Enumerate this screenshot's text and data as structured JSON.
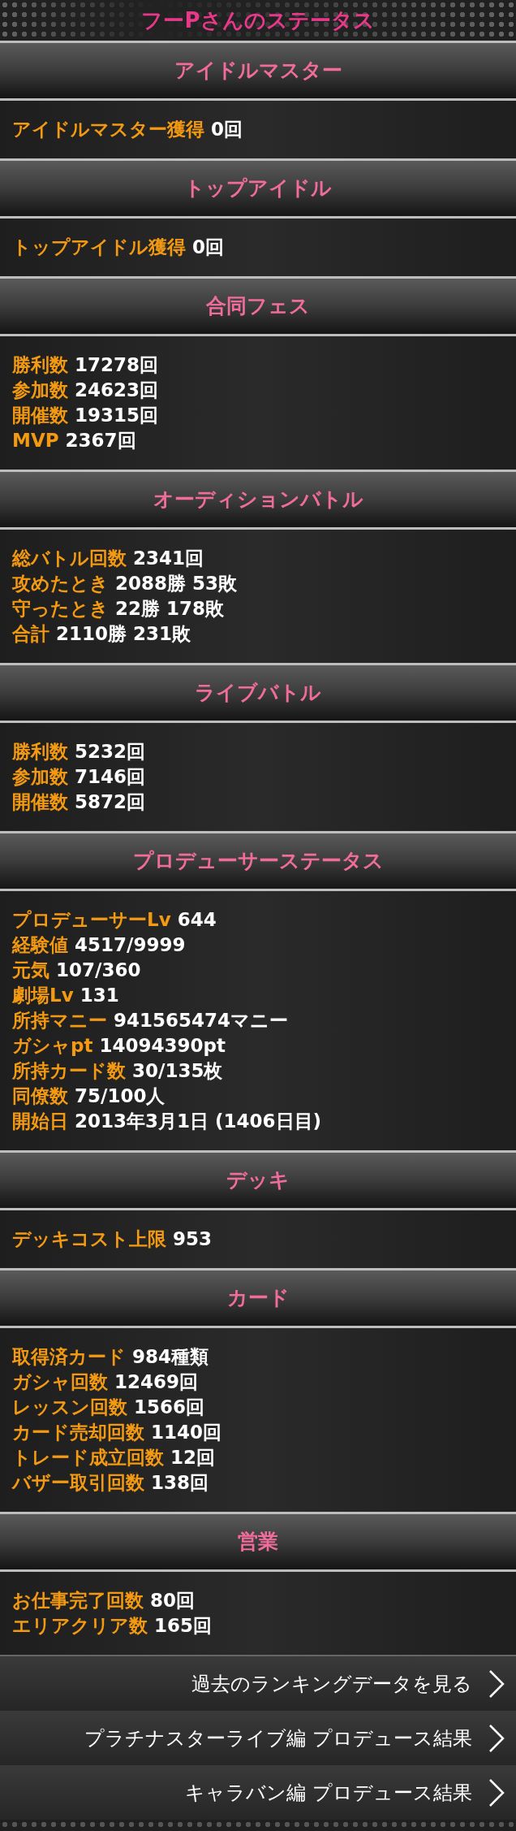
{
  "title": "フーPさんのステータス",
  "sections": [
    {
      "heading": "アイドルマスター",
      "rows": [
        {
          "label": "アイドルマスター獲得",
          "value": "0回"
        }
      ]
    },
    {
      "heading": "トップアイドル",
      "rows": [
        {
          "label": "トップアイドル獲得",
          "value": "0回"
        }
      ]
    },
    {
      "heading": "合同フェス",
      "rows": [
        {
          "label": "勝利数",
          "value": "17278回"
        },
        {
          "label": "参加数",
          "value": "24623回"
        },
        {
          "label": "開催数",
          "value": "19315回"
        },
        {
          "label": "MVP",
          "value": "2367回"
        }
      ]
    },
    {
      "heading": "オーディションバトル",
      "rows": [
        {
          "label": "総バトル回数",
          "value": "2341回"
        },
        {
          "label": "攻めたとき",
          "value": "2088勝 53敗"
        },
        {
          "label": "守ったとき",
          "value": "22勝 178敗"
        },
        {
          "label": "合計",
          "value": "2110勝 231敗"
        }
      ]
    },
    {
      "heading": "ライブバトル",
      "rows": [
        {
          "label": "勝利数",
          "value": "5232回"
        },
        {
          "label": "参加数",
          "value": "7146回"
        },
        {
          "label": "開催数",
          "value": "5872回"
        }
      ]
    },
    {
      "heading": "プロデューサーステータス",
      "rows": [
        {
          "label": "プロデューサーLv",
          "value": "644"
        },
        {
          "label": "経験値",
          "value": "4517/9999"
        },
        {
          "label": "元気",
          "value": "107/360"
        },
        {
          "label": "劇場Lv",
          "value": "131"
        },
        {
          "label": "所持マニー",
          "value": "941565474マニー"
        },
        {
          "label": "ガシャpt",
          "value": "14094390pt"
        },
        {
          "label": "所持カード数",
          "value": "30/135枚"
        },
        {
          "label": "同僚数",
          "value": "75/100人"
        },
        {
          "label": "開始日",
          "value": "2013年3月1日 (1406日目)"
        }
      ]
    },
    {
      "heading": "デッキ",
      "rows": [
        {
          "label": "デッキコスト上限",
          "value": "953"
        }
      ]
    },
    {
      "heading": "カード",
      "rows": [
        {
          "label": "取得済カード",
          "value": "984種類"
        },
        {
          "label": "ガシャ回数",
          "value": "12469回"
        },
        {
          "label": "レッスン回数",
          "value": "1566回"
        },
        {
          "label": "カード売却回数",
          "value": "1140回"
        },
        {
          "label": "トレード成立回数",
          "value": "12回"
        },
        {
          "label": "バザー取引回数",
          "value": "138回"
        }
      ]
    },
    {
      "heading": "営業",
      "rows": [
        {
          "label": "お仕事完了回数",
          "value": "80回"
        },
        {
          "label": "エリアクリア数",
          "value": "165回"
        }
      ]
    }
  ],
  "links": [
    {
      "label": "過去のランキングデータを見る"
    },
    {
      "label": "プラチナスターライブ編 プロデュース結果"
    },
    {
      "label": "キャラバン編 プロデュース結果"
    }
  ]
}
